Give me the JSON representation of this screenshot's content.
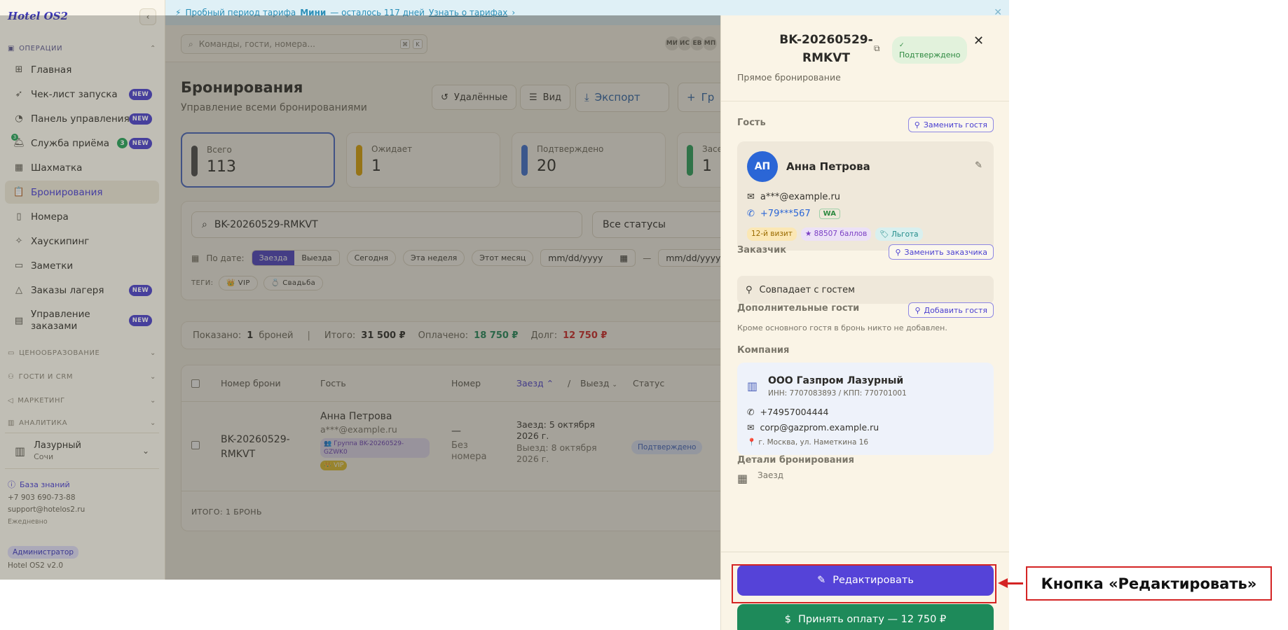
{
  "brand": "Hotel OS2",
  "trial": {
    "prefix": "Пробный период тарифа",
    "plan": "Мини",
    "suffix": "— осталось 117 дней",
    "link": "Узнать о тарифах"
  },
  "sidebar": {
    "operations_label": "ОПЕРАЦИИ",
    "items": [
      {
        "label": "Главная",
        "icon": "grid-icon"
      },
      {
        "label": "Чек-лист запуска",
        "icon": "rocket-icon",
        "new": "NEW"
      },
      {
        "label": "Панель управления",
        "icon": "gauge-icon",
        "new": "NEW"
      },
      {
        "label": "Служба приёма",
        "icon": "bell-icon",
        "count": "3",
        "new": "NEW"
      },
      {
        "label": "Шахматка",
        "icon": "table-icon"
      },
      {
        "label": "Бронирования",
        "icon": "clipboard-icon"
      },
      {
        "label": "Номера",
        "icon": "door-icon"
      },
      {
        "label": "Хаускипинг",
        "icon": "sparkle-icon"
      },
      {
        "label": "Заметки",
        "icon": "note-icon"
      },
      {
        "label": "Заказы лагеря",
        "icon": "tent-icon",
        "new": "NEW"
      },
      {
        "label": "Управление",
        "label2": "заказами",
        "icon": "orders-icon",
        "new": "NEW"
      }
    ],
    "sections": [
      "ЦЕНООБРАЗОВАНИЕ",
      "ГОСТИ И CRM",
      "МАРКЕТИНГ",
      "АНАЛИТИКА"
    ],
    "hotel_name": "Лазурный",
    "hotel_city": "Сочи",
    "kb_link": "База знаний",
    "phone": "+7 903 690-73-88",
    "email": "support@hotelos2.ru",
    "schedule": "Ежедневно",
    "role": "Администратор",
    "version": "Hotel OS2 v2.0"
  },
  "topbar": {
    "search_placeholder": "Команды, гости, номера...",
    "kbd1": "⌘",
    "kbd2": "K",
    "avatars": [
      "МИ",
      "ИС",
      "ЕВ",
      "МП"
    ]
  },
  "page": {
    "title": "Бронирования",
    "subtitle": "Управление всеми бронированиями",
    "btn_deleted": "Удалённые",
    "btn_view": "Вид",
    "btn_export": "Экспорт",
    "btn_group": "Гр"
  },
  "stats": [
    {
      "label": "Всего",
      "value": "113",
      "color": "#4a4a4a"
    },
    {
      "label": "Ожидает",
      "value": "1",
      "color": "#e0a400"
    },
    {
      "label": "Подтверждено",
      "value": "20",
      "color": "#3b6fd6"
    },
    {
      "label": "Засе",
      "value": "1",
      "color": "#27a35a"
    }
  ],
  "filters": {
    "search_value": "BK-20260529-RMKVT",
    "status_select": "Все статусы",
    "by_date": "По дате:",
    "seg_checkin": "Заезда",
    "seg_checkout": "Выезда",
    "today": "Сегодня",
    "week": "Эта неделя",
    "month": "Этот месяц",
    "date_placeholder": "mm/dd/yyyy",
    "dash": "—",
    "tags_label": "ТЕГИ:",
    "tag_vip": "👑 VIP",
    "tag_wedding": "💍 Свадьба"
  },
  "summary": {
    "shown_label": "Показано:",
    "shown_value": "1",
    "shown_suffix": "броней",
    "total_label": "Итого:",
    "total_value": "31 500 ₽",
    "paid_label": "Оплачено:",
    "paid_value": "18 750 ₽",
    "debt_label": "Долг:",
    "debt_value": "12 750 ₽"
  },
  "table": {
    "headers": {
      "number": "Номер брони",
      "guest": "Гость",
      "room": "Номер",
      "checkin": "Заезд",
      "slash": "/",
      "checkout": "Выезд",
      "status": "Статус"
    },
    "row": {
      "number_1": "BK-20260529-",
      "number_2": "RMKVT",
      "guest_name": "Анна Петрова",
      "guest_email": "a***@example.ru",
      "group_tag_1": "👥 Группа BK-20260529-",
      "group_tag_2": "GZWK0",
      "vip_tag": "👑 VIP",
      "room_dash": "—",
      "room_none_1": "Без",
      "room_none_2": "номера",
      "checkin_1": "Заезд: 5 октября",
      "checkin_2": "2026 г.",
      "checkout_1": "Выезд: 8 октября",
      "checkout_2": "2026 г.",
      "status": "Подтверждено"
    },
    "footer": "ИТОГО: 1 БРОНЬ"
  },
  "drawer": {
    "title_1": "BK-20260529-",
    "title_2": "RMKVT",
    "status": "Подтверждено",
    "source": "Прямое бронирование",
    "guest_section": "Гость",
    "replace_guest": "Заменить гостя",
    "guest_initials": "АП",
    "guest_name": "Анна Петрова",
    "guest_email": "a***@example.ru",
    "guest_phone": "+79***567",
    "wa": "WA",
    "visit_tag": "12-й визит",
    "points_tag": "★ 88507 баллов",
    "benefit_tag": "🏷 Льгота",
    "customer_section": "Заказчик",
    "replace_customer": "Заменить заказчика",
    "customer_same": "Совпадает с гостем",
    "extra_section": "Дополнительные гости",
    "add_guest": "Добавить гостя",
    "extra_note": "Кроме основного гостя в бронь никто не добавлен.",
    "company_section": "Компания",
    "company_name": "ООО Газпром Лазурный",
    "company_ids": "ИНН: 7707083893 / КПП: 770701001",
    "company_phone": "+74957004444",
    "company_email": "corp@gazprom.example.ru",
    "company_address": "📍 г. Москва, ул. Наметкина 16",
    "details_section": "Детали бронирования",
    "checkin_label": "Заезд",
    "edit_button": "Редактировать",
    "pay_button": "Принять оплату — 12 750 ₽"
  },
  "annotation": {
    "callout": "Кнопка «Редактировать»"
  }
}
